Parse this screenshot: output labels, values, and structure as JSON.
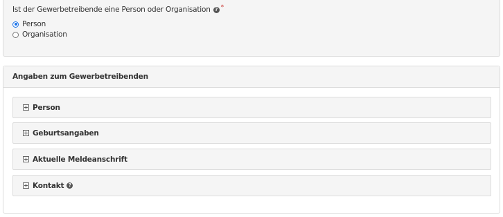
{
  "form": {
    "question": "Ist der Gewerbetreibende eine Person oder Organisation",
    "required_marker": "*",
    "options": [
      {
        "label": "Person",
        "selected": true
      },
      {
        "label": "Organisation",
        "selected": false
      }
    ]
  },
  "details_panel": {
    "title": "Angaben zum Gewerbetreibenden",
    "sections": [
      {
        "label": "Person",
        "has_help": false
      },
      {
        "label": "Geburtsangaben",
        "has_help": false
      },
      {
        "label": "Aktuelle Meldeanschrift",
        "has_help": false
      },
      {
        "label": "Kontakt",
        "has_help": true
      }
    ]
  },
  "icons": {
    "help": "question-circle-icon",
    "expand": "plus-square-icon"
  },
  "colors": {
    "radio_accent": "#1a73e8",
    "required": "#c9302c",
    "panel_bg": "#f5f5f5",
    "border": "#dcdcdc"
  }
}
